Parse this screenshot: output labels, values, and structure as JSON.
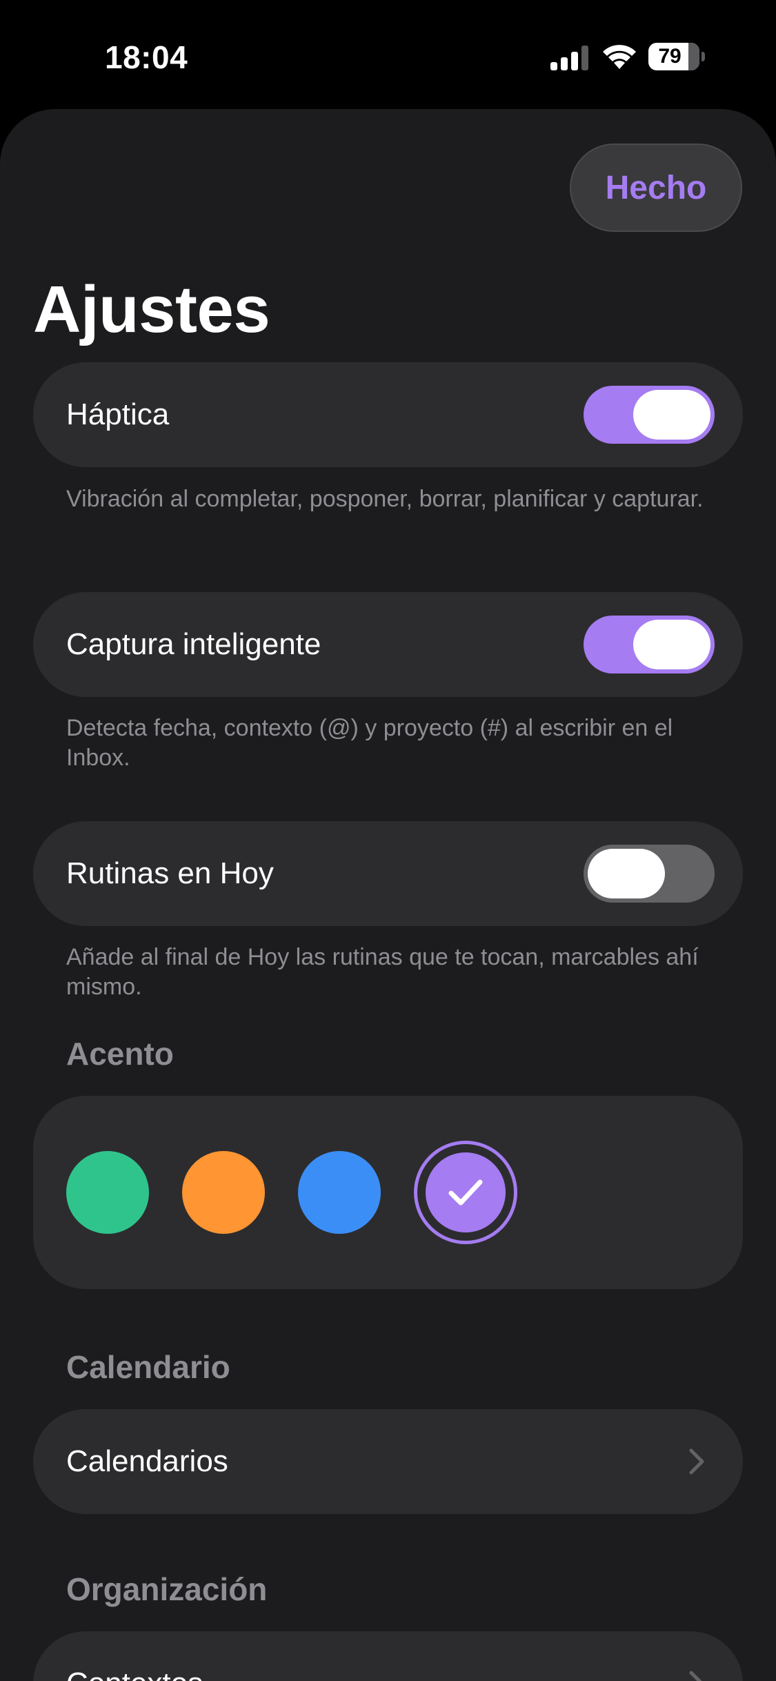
{
  "status_bar": {
    "time": "18:04",
    "battery_level": "79",
    "battery_fraction": 0.79,
    "icons": [
      "signal-icon",
      "wifi-icon",
      "battery-icon"
    ]
  },
  "header": {
    "done_label": "Hecho",
    "title": "Ajustes"
  },
  "settings": [
    {
      "label": "Háptica",
      "enabled": true,
      "footnote": "Vibración al completar, posponer, borrar, planificar y capturar."
    },
    {
      "label": "Captura inteligente",
      "enabled": true,
      "footnote": "Detecta fecha, contexto (@) y proyecto (#) al escribir en el Inbox."
    },
    {
      "label": "Rutinas en Hoy",
      "enabled": false,
      "footnote": "Añade al final de Hoy las rutinas que te tocan, marcables ahí mismo."
    }
  ],
  "accent": {
    "header": "Acento",
    "colors": [
      "#30c48d",
      "#ff9533",
      "#3c8ef7",
      "#a57cf2"
    ],
    "selected_index": 3
  },
  "calendar": {
    "header": "Calendario",
    "item_label": "Calendarios"
  },
  "organization": {
    "header": "Organización",
    "item_label": "Contextos"
  },
  "colors": {
    "accent": "#a57cf2",
    "background": "#1c1c1e",
    "card": "#2c2c2e",
    "secondary_text": "#8e8e93"
  }
}
